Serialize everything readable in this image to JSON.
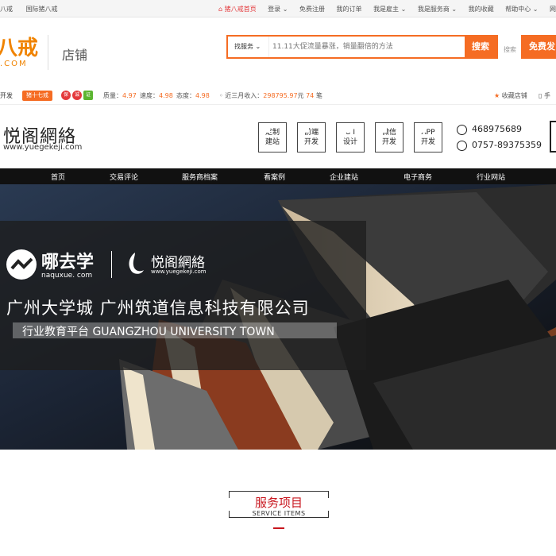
{
  "topbar": {
    "left": [
      "八戒",
      "国际猪八戒"
    ],
    "home": "猪八戒首页",
    "right": [
      "登录 ⌄",
      "免费注册",
      "我的订单",
      "我是雇主 ⌄",
      "我是服务商 ⌄",
      "我的收藏",
      "帮助中心 ⌄",
      "网"
    ]
  },
  "header": {
    "logo_text": "八戒",
    "logo_com": ".COM",
    "store_label": "店铺",
    "search_category": "找服务 ⌄",
    "search_placeholder": "11.11大促流量暴涨，销量翻倍的方法",
    "search_button": "搜索",
    "search_link": "搜索",
    "publish_button": "免费发"
  },
  "storebar": {
    "name": "开发",
    "level_badge": "猪十七戒",
    "icons": [
      "保",
      "诚",
      "证"
    ],
    "quality_label": "质量：",
    "quality": "4.97",
    "speed_label": "速度：",
    "speed": "4.98",
    "attitude_label": "态度：",
    "attitude": "4.98",
    "income_label": "近三月收入：",
    "income": "298795.97",
    "income_unit": "元",
    "orders": "74",
    "orders_unit": "笔",
    "favorite": "收藏店铺",
    "mobile": "手"
  },
  "brand": {
    "name": "悦阁網絡",
    "url": "www.yuegekeji.com",
    "services": [
      {
        "line1": "定制",
        "line2": "建站"
      },
      {
        "line1": "前端",
        "line2": "开发"
      },
      {
        "line1": "U I",
        "line2": "设计"
      },
      {
        "line1": "微信",
        "line2": "开发"
      },
      {
        "line1": "APP",
        "line2": "开发"
      }
    ],
    "qq": "468975689",
    "phone": "0757-89375359"
  },
  "nav": [
    "首页",
    "交易评论",
    "服务商档案",
    "看案例",
    "企业建站",
    "电子商务",
    "行业网站"
  ],
  "banner": {
    "naqu_name": "哪去学",
    "naqu_url": "naquxue. com",
    "yg_name": "悦阁網絡",
    "yg_url": "www.yuegekeji.com",
    "headline": "广州大学城 广州筑道信息科技有限公司",
    "subline": "行业教育平台 GUANGZHOU UNIVERSITY TOWN"
  },
  "section": {
    "title": "服务项目",
    "subtitle": "SERVICE ITEMS"
  },
  "colors": {
    "accent": "#f56c23",
    "nav_bg": "#111111",
    "section_red": "#c8161e"
  }
}
